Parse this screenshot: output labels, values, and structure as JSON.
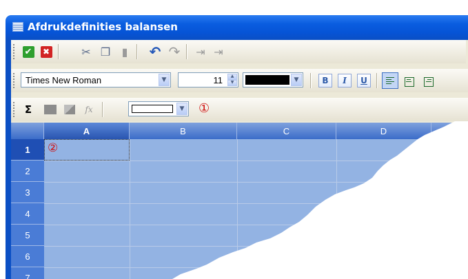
{
  "window": {
    "title": "Afdrukdefinities balansen",
    "icon": "table-icon"
  },
  "toolbar1": {
    "buttons": [
      {
        "name": "ok-button",
        "icon": "check-icon",
        "glyph": "✔"
      },
      {
        "name": "cancel-button",
        "icon": "close-icon",
        "glyph": "✖"
      },
      {
        "name": "cut-button",
        "icon": "scissors-icon",
        "glyph": "✂"
      },
      {
        "name": "copy-button",
        "icon": "copy-icon",
        "glyph": "❐"
      },
      {
        "name": "paste-button",
        "icon": "paste-icon",
        "glyph": "▮"
      },
      {
        "name": "undo-button",
        "icon": "undo-icon",
        "glyph": "↶"
      },
      {
        "name": "redo-button",
        "icon": "redo-icon",
        "glyph": "↷"
      },
      {
        "name": "insert-column-button",
        "icon": "insert-column-icon",
        "glyph": "⇥"
      },
      {
        "name": "insert-row-button",
        "icon": "insert-row-icon",
        "glyph": "⇥"
      }
    ]
  },
  "toolbar2": {
    "font_name": "Times New Roman",
    "font_size": "11",
    "font_color": "#000000",
    "bold": "B",
    "italic": "I",
    "underline": "U"
  },
  "toolbar3": {
    "sum_glyph": "Σ",
    "fx_glyph": "fx",
    "border_value": "",
    "callout": "①"
  },
  "grid": {
    "columns": [
      "A",
      "B",
      "C",
      "D"
    ],
    "rows": [
      "1",
      "2",
      "3",
      "4",
      "5",
      "6",
      "7"
    ],
    "selected_cell_callout": "②",
    "cell_color": "#93b3e3",
    "header_color": "#4a7cd6"
  }
}
